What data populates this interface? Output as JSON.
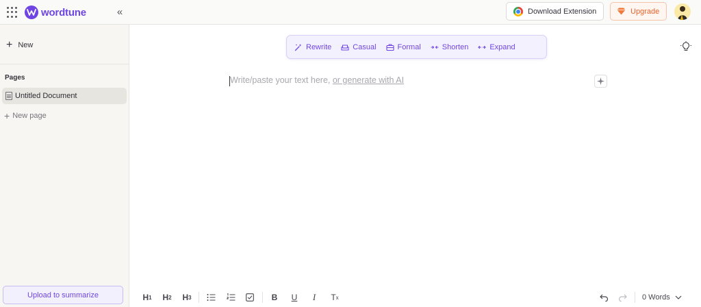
{
  "header": {
    "logo_text": "wordtune",
    "download_extension_label": "Download Extension",
    "upgrade_label": "Upgrade"
  },
  "sidebar": {
    "new_label": "New",
    "pages_heading": "Pages",
    "pages": [
      {
        "title": "Untitled Document",
        "selected": true
      }
    ],
    "new_page_label": "New page",
    "upload_label": "Upload to summarize"
  },
  "rewrite_toolbar": {
    "items": [
      {
        "label": "Rewrite",
        "icon": "magic-wand-icon"
      },
      {
        "label": "Casual",
        "icon": "sofa-icon"
      },
      {
        "label": "Formal",
        "icon": "briefcase-icon"
      },
      {
        "label": "Shorten",
        "icon": "shorten-icon"
      },
      {
        "label": "Expand",
        "icon": "expand-icon"
      }
    ]
  },
  "editor": {
    "placeholder": "Write/paste your text here, ",
    "generate_link": "or generate with AI"
  },
  "bottom_toolbar": {
    "h1": "H",
    "h1_sub": "1",
    "h2": "H",
    "h2_sub": "2",
    "h3": "H",
    "h3_sub": "3",
    "bold": "B",
    "underline": "U",
    "italic": "I",
    "clear_format": "T",
    "clear_format_sub": "x",
    "word_count": "0 Words"
  },
  "colors": {
    "brand": "#6e45e2",
    "upgrade": "#e8622a"
  }
}
